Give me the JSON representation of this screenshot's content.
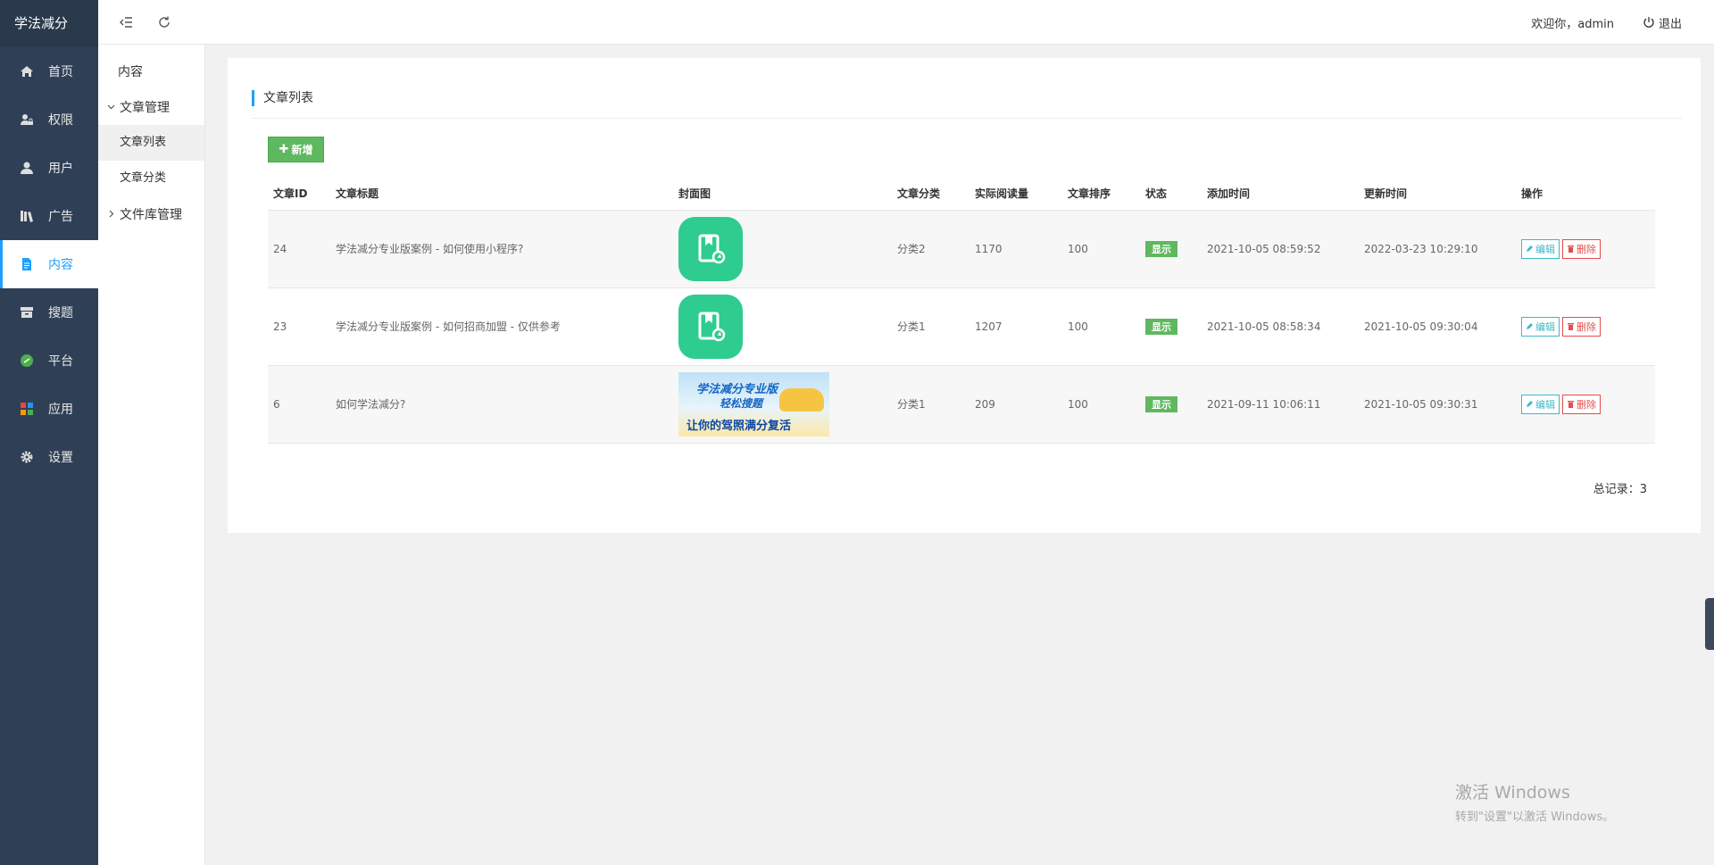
{
  "brand": "学法减分",
  "nav": [
    {
      "label": "首页",
      "icon": "home-icon"
    },
    {
      "label": "权限",
      "icon": "user-lock-icon"
    },
    {
      "label": "用户",
      "icon": "user-icon"
    },
    {
      "label": "广告",
      "icon": "books-icon"
    },
    {
      "label": "内容",
      "icon": "document-icon",
      "active": true
    },
    {
      "label": "搜题",
      "icon": "archive-icon"
    },
    {
      "label": "平台",
      "icon": "link-icon"
    },
    {
      "label": "应用",
      "icon": "apps-icon"
    },
    {
      "label": "设置",
      "icon": "gear-icon"
    }
  ],
  "subnav": {
    "title": "内容",
    "groups": [
      {
        "label": "文章管理",
        "expanded": true,
        "children": [
          {
            "label": "文章列表",
            "active": true
          },
          {
            "label": "文章分类",
            "active": false
          }
        ]
      },
      {
        "label": "文件库管理",
        "expanded": false,
        "children": []
      }
    ]
  },
  "header": {
    "welcome": "欢迎你，admin",
    "logout": "退出"
  },
  "card": {
    "title": "文章列表",
    "add_label": "新增",
    "columns": [
      "文章ID",
      "文章标题",
      "封面图",
      "文章分类",
      "实际阅读量",
      "文章排序",
      "状态",
      "添加时间",
      "更新时间",
      "操作"
    ],
    "rows": [
      {
        "id": "24",
        "title": "学法减分专业版案例 - 如何使用小程序?",
        "cover": "app-icon",
        "category": "分类2",
        "reads": "1170",
        "sort": "100",
        "status": "显示",
        "added": "2021-10-05 08:59:52",
        "updated": "2022-03-23 10:29:10"
      },
      {
        "id": "23",
        "title": "学法减分专业版案例 - 如何招商加盟 - 仅供参考",
        "cover": "app-icon",
        "category": "分类1",
        "reads": "1207",
        "sort": "100",
        "status": "显示",
        "added": "2021-10-05 08:58:34",
        "updated": "2021-10-05 09:30:04"
      },
      {
        "id": "6",
        "title": "如何学法减分?",
        "cover": "banner",
        "category": "分类1",
        "reads": "209",
        "sort": "100",
        "status": "显示",
        "added": "2021-09-11 10:06:11",
        "updated": "2021-10-05 09:30:31"
      }
    ],
    "edit_label": "编辑",
    "delete_label": "删除",
    "total": "总记录：3"
  },
  "banner": {
    "line1": "学法减分专业版",
    "line2": "轻松搜题",
    "line3": "让你的驾照满分复活"
  },
  "watermark": {
    "line1": "激活 Windows",
    "line2": "转到\"设置\"以激活 Windows。"
  },
  "colors": {
    "sidebar": "#2f4056",
    "accent": "#1e9fff",
    "add_button": "#5fb85f",
    "status": "#5fb85f",
    "delete": "#e54d4d"
  }
}
